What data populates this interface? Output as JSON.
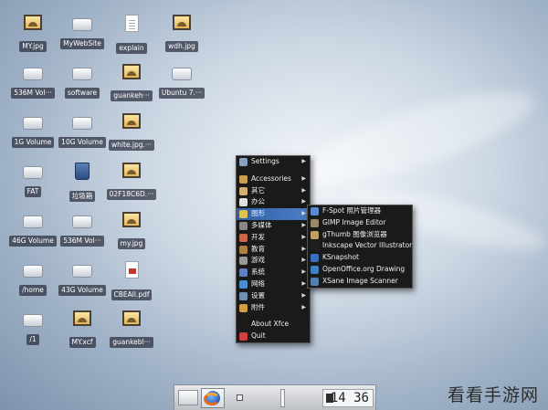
{
  "desktop_icons": [
    {
      "label": "MY.jpg",
      "type": "image"
    },
    {
      "label": "MyWebSite",
      "type": "drive"
    },
    {
      "label": "explain",
      "type": "document"
    },
    {
      "label": "wdh.jpg",
      "type": "image"
    },
    {
      "label": "536M Vol···",
      "type": "drive"
    },
    {
      "label": "software",
      "type": "drive"
    },
    {
      "label": "guankeh···",
      "type": "image"
    },
    {
      "label": "Ubuntu 7.···",
      "type": "drive"
    },
    {
      "label": "1G Volume",
      "type": "drive"
    },
    {
      "label": "10G Volume",
      "type": "drive"
    },
    {
      "label": "white.jpg.···",
      "type": "image"
    },
    {
      "label": "FAT",
      "type": "drive"
    },
    {
      "label": "垃圾箱",
      "type": "trash"
    },
    {
      "label": "02F18C6D.···",
      "type": "image"
    },
    {
      "label": "46G Volume",
      "type": "drive"
    },
    {
      "label": "536M Vol···",
      "type": "drive"
    },
    {
      "label": "my.jpg",
      "type": "image"
    },
    {
      "label": "/home",
      "type": "drive"
    },
    {
      "label": "43G Volume",
      "type": "drive"
    },
    {
      "label": "CBEAll.pdf",
      "type": "pdf"
    },
    {
      "label": "/1",
      "type": "drive"
    },
    {
      "label": "MY.xcf",
      "type": "image"
    },
    {
      "label": "guankebl···",
      "type": "image"
    }
  ],
  "main_menu": {
    "items": [
      {
        "label": "Settings",
        "submenu": true,
        "icon": "settings-icon",
        "color": "#8aa0c0"
      },
      {
        "separator": true
      },
      {
        "label": "Accessories",
        "submenu": true,
        "icon": "accessories-icon",
        "color": "#c8a050"
      },
      {
        "label": "其它",
        "submenu": true,
        "icon": "other-icon",
        "color": "#d4b070"
      },
      {
        "label": "办公",
        "submenu": true,
        "icon": "office-icon",
        "color": "#e0e0e0"
      },
      {
        "label": "图形",
        "submenu": true,
        "icon": "graphics-icon",
        "color": "#e0c050",
        "active": true
      },
      {
        "label": "多媒体",
        "submenu": true,
        "icon": "multimedia-icon",
        "color": "#888888"
      },
      {
        "label": "开发",
        "submenu": true,
        "icon": "development-icon",
        "color": "#cc6644"
      },
      {
        "label": "教育",
        "submenu": true,
        "icon": "education-icon",
        "color": "#b08040"
      },
      {
        "label": "游戏",
        "submenu": true,
        "icon": "games-icon",
        "color": "#999999"
      },
      {
        "label": "系统",
        "submenu": true,
        "icon": "system-icon",
        "color": "#6080c0"
      },
      {
        "label": "网络",
        "submenu": true,
        "icon": "network-icon",
        "color": "#4a90d0"
      },
      {
        "label": "设置",
        "submenu": true,
        "icon": "preferences-icon",
        "color": "#7090b0"
      },
      {
        "label": "附件",
        "submenu": true,
        "icon": "accessory-icon",
        "color": "#d0a040"
      },
      {
        "separator": true
      },
      {
        "label": "About Xfce",
        "submenu": false,
        "icon": "",
        "color": ""
      },
      {
        "label": "Quit",
        "submenu": false,
        "icon": "quit-icon",
        "color": "#d04040"
      }
    ]
  },
  "graphics_submenu": {
    "items": [
      {
        "label": "F-Spot 照片管理器",
        "icon": "f-spot-icon",
        "color": "#5a8ad0"
      },
      {
        "label": "GIMP Image Editor",
        "icon": "gimp-icon",
        "color": "#9a8a6a"
      },
      {
        "label": "gThumb 图像浏览器",
        "icon": "gthumb-icon",
        "color": "#c0a060"
      },
      {
        "label": "Inkscape Vector Illustrator",
        "icon": "inkscape-icon",
        "color": "#202020"
      },
      {
        "label": "KSnapshot",
        "icon": "ksnapshot-icon",
        "color": "#3a70c0"
      },
      {
        "label": "OpenOffice.org Drawing",
        "icon": "openoffice-draw-icon",
        "color": "#4080c0"
      },
      {
        "label": "XSane Image Scanner",
        "icon": "xsane-icon",
        "color": "#5080b0"
      }
    ]
  },
  "taskbar": {
    "clock": "14 36"
  },
  "watermark": "看看手游网"
}
